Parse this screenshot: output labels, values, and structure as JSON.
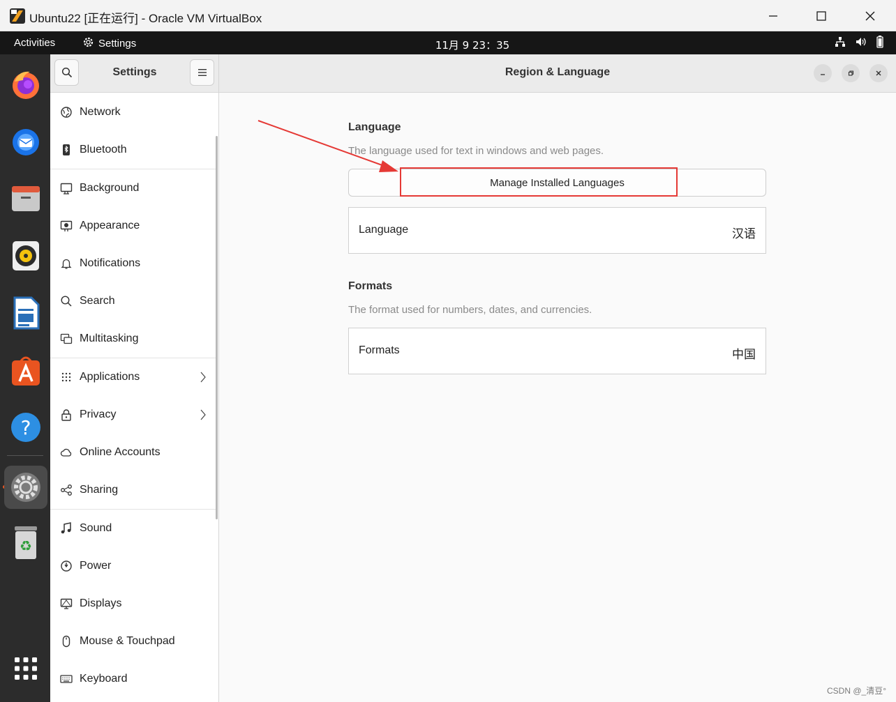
{
  "host": {
    "title": "Ubuntu22 [正在运行] - Oracle VM VirtualBox"
  },
  "panel": {
    "activities": "Activities",
    "app_name": "Settings",
    "clock": "11月 9  23：35"
  },
  "dock": {
    "items": [
      "firefox-icon",
      "thunderbird-icon",
      "files-icon",
      "rhythmbox-icon",
      "libreoffice-writer-icon",
      "app-center-icon",
      "help-icon",
      "settings-icon",
      "trash-icon",
      "show-apps-icon"
    ],
    "active": "settings-icon"
  },
  "sidebar": {
    "title": "Settings",
    "items": [
      {
        "label": "Network",
        "icon": "network-icon"
      },
      {
        "label": "Bluetooth",
        "icon": "bluetooth-icon"
      },
      {
        "label": "Background",
        "icon": "background-icon"
      },
      {
        "label": "Appearance",
        "icon": "appearance-icon"
      },
      {
        "label": "Notifications",
        "icon": "bell-icon"
      },
      {
        "label": "Search",
        "icon": "search-icon"
      },
      {
        "label": "Multitasking",
        "icon": "multitasking-icon"
      },
      {
        "label": "Applications",
        "icon": "grid-icon"
      },
      {
        "label": "Privacy",
        "icon": "lock-icon"
      },
      {
        "label": "Online Accounts",
        "icon": "cloud-icon"
      },
      {
        "label": "Sharing",
        "icon": "share-icon"
      },
      {
        "label": "Sound",
        "icon": "music-note-icon"
      },
      {
        "label": "Power",
        "icon": "power-icon"
      },
      {
        "label": "Displays",
        "icon": "display-icon"
      },
      {
        "label": "Mouse & Touchpad",
        "icon": "mouse-icon"
      },
      {
        "label": "Keyboard",
        "icon": "keyboard-icon"
      }
    ]
  },
  "main": {
    "title": "Region & Language",
    "language_section": {
      "title": "Language",
      "description": "The language used for text in windows and web pages.",
      "manage_button": "Manage Installed Languages",
      "row_label": "Language",
      "row_value": "汉语"
    },
    "formats_section": {
      "title": "Formats",
      "description": "The format used for numbers, dates, and currencies.",
      "row_label": "Formats",
      "row_value": "中国"
    }
  },
  "annotation": {
    "color": "#e53935"
  },
  "watermark": "CSDN @_清豆°"
}
